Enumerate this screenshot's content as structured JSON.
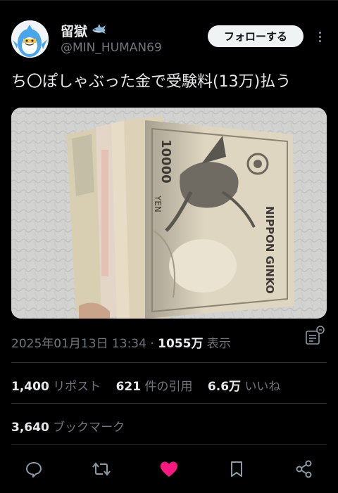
{
  "author": {
    "display_name": "留獄",
    "handle": "@MIN_HUMAN69"
  },
  "follow_label": "フォローする",
  "tweet": {
    "text": "ち〇ぽしゃぶった金で受験料(13万)払う"
  },
  "meta": {
    "datetime": "2025年01月13日 13:34",
    "separator": "·",
    "views_count": "1055万",
    "views_label": "表示"
  },
  "stats": {
    "reposts_count": "1,400",
    "reposts_label": "リポスト",
    "quotes_count": "621",
    "quotes_label": "件の引用",
    "likes_count": "6.6万",
    "likes_label": "いいね",
    "bookmarks_count": "3,640",
    "bookmarks_label": "ブックマーク"
  },
  "colors": {
    "background": "#000000",
    "text_primary": "#e7e9ea",
    "text_secondary": "#71767b",
    "like_active": "#f91880",
    "action_icon": "#8b98a5"
  },
  "icons": [
    "shark-emoji-icon",
    "more-options-icon",
    "analytics-icon",
    "reply-icon",
    "retweet-icon",
    "like-icon",
    "bookmark-icon",
    "share-icon"
  ]
}
